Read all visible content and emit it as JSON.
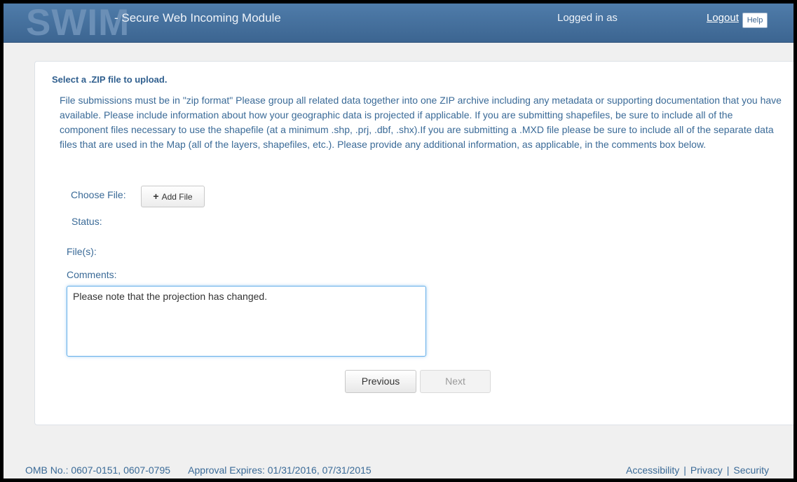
{
  "header": {
    "logo": "SWIM",
    "title": "- Secure Web Incoming Module",
    "logged_in_label": "Logged in as",
    "logout_label": "Logout",
    "help_label": "Help"
  },
  "form": {
    "section_title": "Select a .ZIP file to upload.",
    "description": "File submissions must be in \"zip format\" Please group all related data together into one ZIP archive including any metadata or supporting documentation that you have available. Please include information about how your geographic data is projected if applicable. If you are submitting shapefiles, be sure to include all of the component files necessary to use the shapefile (at a minimum .shp, .prj, .dbf, .shx).If you are submitting a .MXD file please be sure to include all of the separate data files that are used in the Map (all of the layers, shapefiles, etc.). Please provide any additional information, as applicable, in the comments box below.",
    "choose_file_label": "Choose File:",
    "add_file_label": "Add File",
    "status_label": "Status:",
    "files_label": "File(s):",
    "comments_label": "Comments:",
    "comments_value": "Please note that the projection has changed.",
    "previous_label": "Previous",
    "next_label": "Next"
  },
  "footer": {
    "omb": "OMB No.: 0607-0151, 0607-0795",
    "approval": "Approval Expires: 01/31/2016, 07/31/2015",
    "links": [
      "Accessibility",
      "Privacy",
      "Security"
    ],
    "separator": "|"
  },
  "colors": {
    "header_bg": "#3c6591",
    "text_blue": "#3a6a97",
    "focus_border": "#66afe9"
  }
}
